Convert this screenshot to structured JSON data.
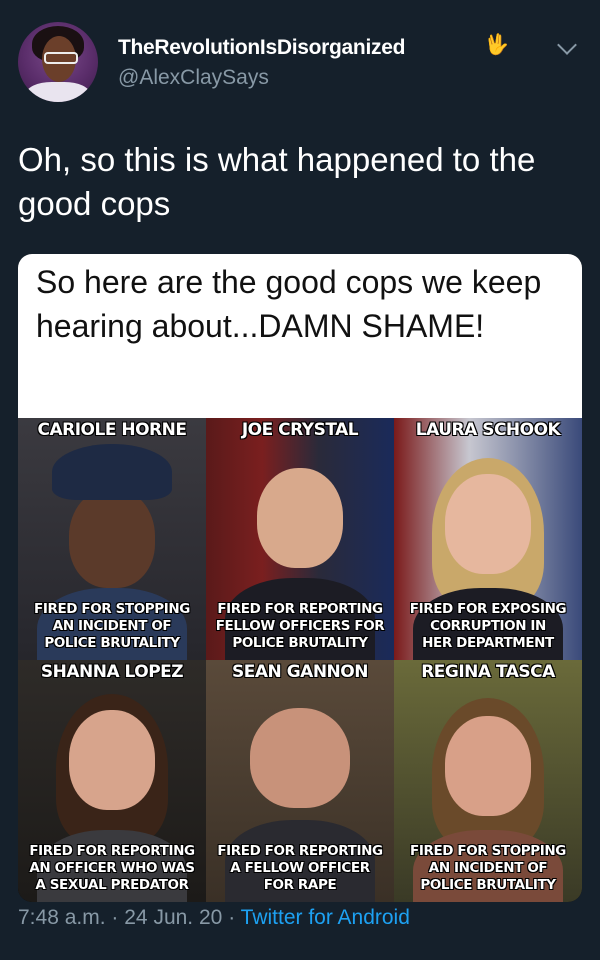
{
  "user": {
    "display_name": "TheRevolutionIsDisorganized",
    "badge_icon": "vulcan-salute-icon",
    "handle": "@AlexClaySays"
  },
  "tweet": {
    "text": "Oh, so this is what happened to the good cops"
  },
  "media": {
    "caption": "So here are the good cops we keep hearing about...DAMN SHAME!",
    "officers": [
      {
        "name": "CARIOLE HORNE",
        "caption": "FIRED FOR STOPPING\nAN INCIDENT OF\nPOLICE BRUTALITY"
      },
      {
        "name": "JOE CRYSTAL",
        "caption": "FIRED FOR REPORTING\nFELLOW OFFICERS FOR\nPOLICE BRUTALITY"
      },
      {
        "name": "LAURA SCHOOK",
        "caption": "FIRED FOR EXPOSING\nCORRUPTION IN\nHER DEPARTMENT"
      },
      {
        "name": "SHANNA LOPEZ",
        "caption": "FIRED FOR REPORTING\nAN OFFICER WHO WAS\nA SEXUAL PREDATOR"
      },
      {
        "name": "SEAN GANNON",
        "caption": "FIRED FOR REPORTING\nA FELLOW OFFICER\nFOR RAPE"
      },
      {
        "name": "REGINA TASCA",
        "caption": "FIRED FOR STOPPING\nAN INCIDENT OF\nPOLICE BRUTALITY"
      }
    ]
  },
  "footer": {
    "time": "7:48 a.m.",
    "separator": "·",
    "date": "24 Jun. 20",
    "source": "Twitter for Android"
  }
}
